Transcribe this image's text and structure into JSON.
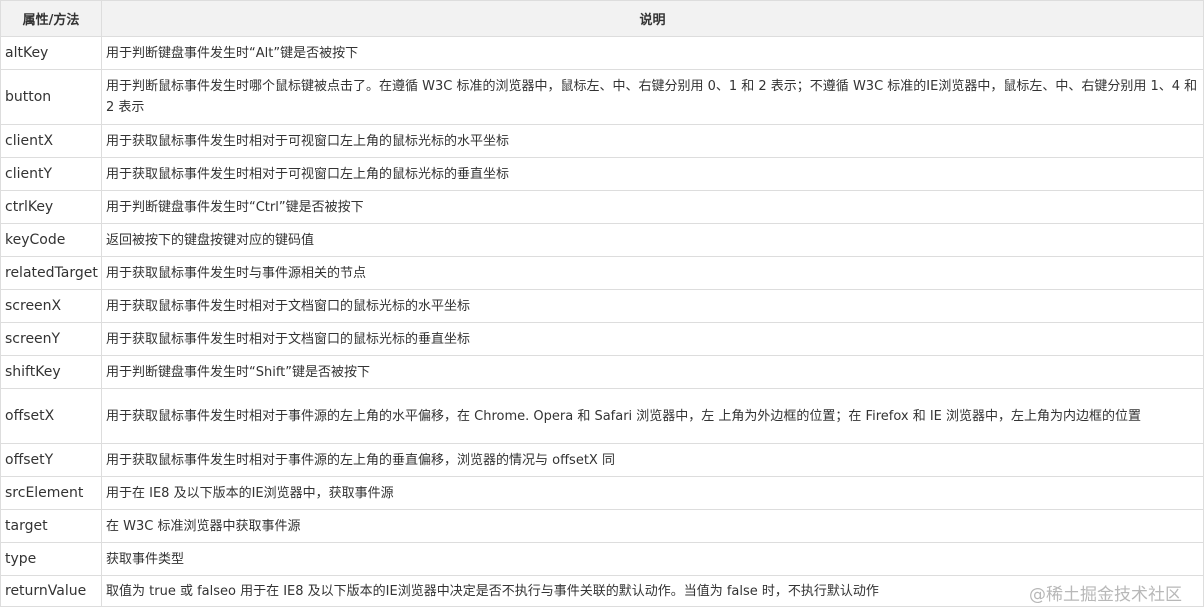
{
  "table": {
    "headers": [
      "属性/方法",
      "说明"
    ],
    "rows": [
      {
        "name": "altKey",
        "desc": "用于判断键盘事件发生时“Alt”键是否被按下"
      },
      {
        "name": "button",
        "desc": "用于判断鼠标事件发生时哪个鼠标键被点击了。在遵循 W3C 标准的浏览器中，鼠标左、中、右键分别用 0、1 和 2 表示；不遵循 W3C 标准的IE浏览器中，鼠标左、中、右键分别用 1、4 和 2 表示"
      },
      {
        "name": "clientX",
        "desc": "用于获取鼠标事件发生时相对于可视窗口左上角的鼠标光标的水平坐标"
      },
      {
        "name": "clientY",
        "desc": "用于获取鼠标事件发生时相对于可视窗口左上角的鼠标光标的垂直坐标"
      },
      {
        "name": "ctrlKey",
        "desc": "用于判断键盘事件发生时“Ctrl”键是否被按下"
      },
      {
        "name": "keyCode",
        "desc": "返回被按下的键盘按键对应的键码值"
      },
      {
        "name": "relatedTarget",
        "desc": "用于获取鼠标事件发生时与事件源相关的节点"
      },
      {
        "name": "screenX",
        "desc": "用于获取鼠标事件发生时相对于文档窗口的鼠标光标的水平坐标"
      },
      {
        "name": "screenY",
        "desc": "用于获取鼠标事件发生时相对于文档窗口的鼠标光标的垂直坐标"
      },
      {
        "name": "shiftKey",
        "desc": "用于判断键盘事件发生时“Shift”键是否被按下"
      },
      {
        "name": "offsetX",
        "desc": "用于获取鼠标事件发生时相对于事件源的左上角的水平偏移，在 Chrome. Opera 和 Safari 浏览器中，左 上角为外边框的位置；在 Firefox 和 IE 浏览器中，左上角为内边框的位置"
      },
      {
        "name": "offsetY",
        "desc": "用于获取鼠标事件发生时相对于事件源的左上角的垂直偏移，浏览器的情况与 offsetX 同"
      },
      {
        "name": "srcElement",
        "desc": "用于在 IE8 及以下版本的IE浏览器中，获取事件源"
      },
      {
        "name": "target",
        "desc": "在 W3C 标准浏览器中获取事件源"
      },
      {
        "name": "type",
        "desc": "获取事件类型"
      },
      {
        "name": "returnValue",
        "desc": "取值为 true 或 falseo 用于在 IE8 及以下版本的IE浏览器中决定是否不执行与事件关联的默认动作。当值为 false 时，不执行默认动作"
      }
    ]
  },
  "watermark": "@稀土掘金技术社区"
}
